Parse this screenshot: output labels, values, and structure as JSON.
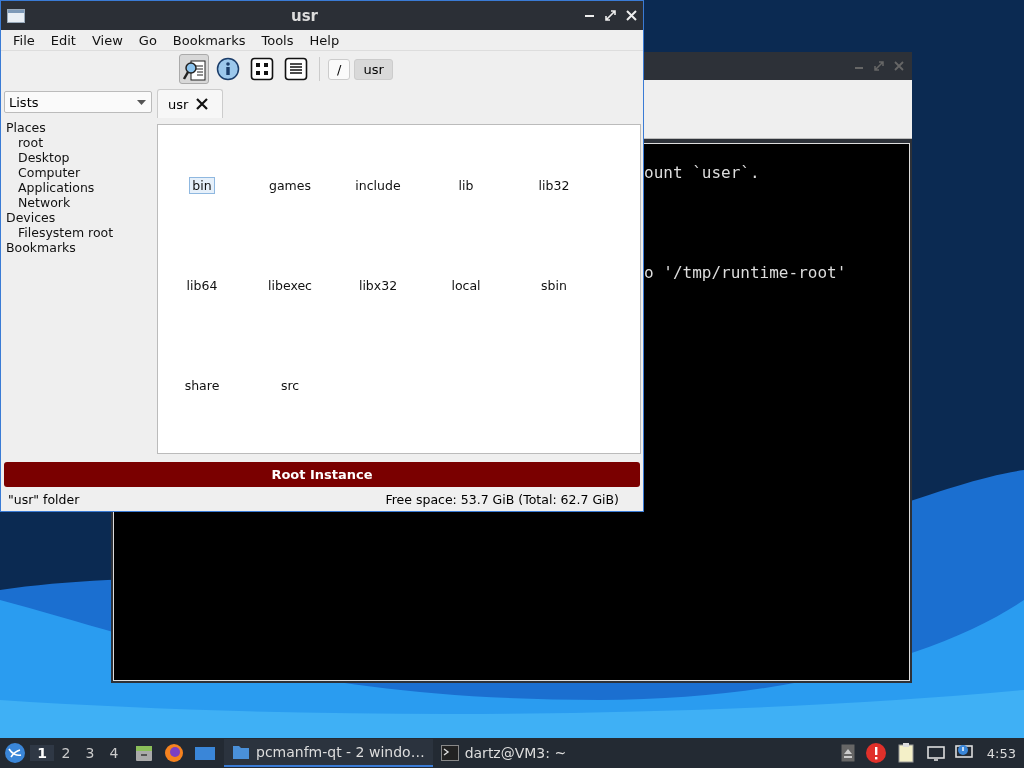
{
  "terminal": {
    "lines": [
      "ount `user`.",
      "o '/tmp/runtime-root'"
    ]
  },
  "file_manager": {
    "title": "usr",
    "menu": [
      "File",
      "Edit",
      "View",
      "Go",
      "Bookmarks",
      "Tools",
      "Help"
    ],
    "toolbar_buttons": [
      {
        "kind": "preview",
        "selected": true
      },
      {
        "kind": "info",
        "selected": false
      },
      {
        "kind": "icons",
        "selected": false
      },
      {
        "kind": "list",
        "selected": false
      }
    ],
    "path_buttons": [
      {
        "label": "/",
        "selected": false
      },
      {
        "label": "usr",
        "selected": true
      }
    ],
    "sidebar": {
      "view_selector": "Lists",
      "tree": [
        {
          "label": "Places",
          "children": [
            {
              "label": "root"
            },
            {
              "label": "Desktop"
            },
            {
              "label": "Computer"
            },
            {
              "label": "Applications"
            },
            {
              "label": "Network"
            }
          ]
        },
        {
          "label": "Devices",
          "children": [
            {
              "label": "Filesystem root"
            }
          ]
        },
        {
          "label": "Bookmarks"
        }
      ]
    },
    "tabs": [
      {
        "label": "usr",
        "selected": true
      }
    ],
    "files": [
      {
        "name": "bin",
        "selected": true
      },
      {
        "name": "games",
        "selected": false
      },
      {
        "name": "include",
        "selected": false
      },
      {
        "name": "lib",
        "selected": false
      },
      {
        "name": "lib32",
        "selected": false
      },
      {
        "name": "lib64",
        "selected": false
      },
      {
        "name": "libexec",
        "selected": false
      },
      {
        "name": "libx32",
        "selected": false
      },
      {
        "name": "local",
        "selected": false
      },
      {
        "name": "sbin",
        "selected": false
      },
      {
        "name": "share",
        "selected": false
      },
      {
        "name": "src",
        "selected": false
      }
    ],
    "banner": "Root Instance",
    "status_bar": {
      "left": "\"usr\" folder",
      "right": "Free space: 53.7 GiB (Total: 62.7 GiB)"
    }
  },
  "taskbar": {
    "workspaces": [
      {
        "label": "1",
        "selected": true
      },
      {
        "label": "2",
        "selected": false
      },
      {
        "label": "3",
        "selected": false
      },
      {
        "label": "4",
        "selected": false
      }
    ],
    "tasks": [
      {
        "label": "pcmanfm-qt - 2 windo…",
        "kind": "folder",
        "selected": true
      },
      {
        "label": "dartz@VM3: ~",
        "kind": "terminal",
        "selected": false
      }
    ],
    "clock": "4:53"
  }
}
